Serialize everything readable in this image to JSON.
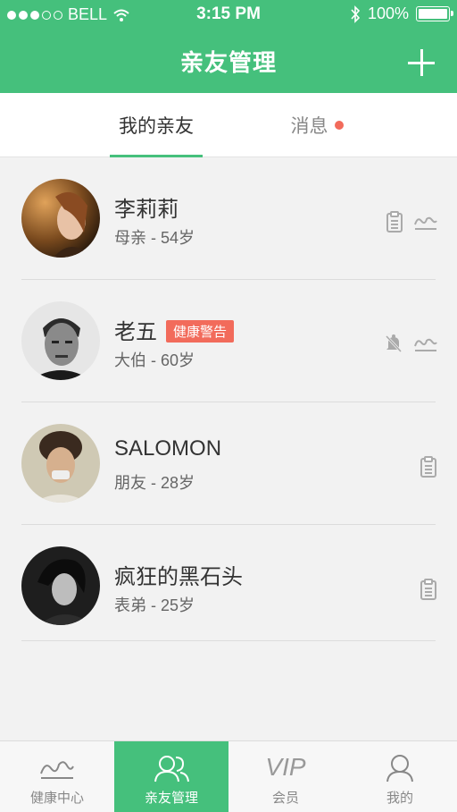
{
  "status_bar": {
    "carrier": "BELL",
    "time": "3:15 PM",
    "battery": "100%"
  },
  "header": {
    "title": "亲友管理",
    "add_icon": "plus-icon"
  },
  "tabs": [
    {
      "label": "我的亲友",
      "active": true
    },
    {
      "label": "消息",
      "has_unread": true
    }
  ],
  "contacts": [
    {
      "name": "李莉莉",
      "relation": "母亲 - 54岁",
      "badge": "",
      "icons": [
        "clipboard-icon",
        "health-trend-icon"
      ]
    },
    {
      "name": "老五",
      "relation": "大伯 - 60岁",
      "badge": "健康警告",
      "icons": [
        "bell-muted-icon",
        "health-trend-icon"
      ]
    },
    {
      "name": "SALOMON",
      "relation": "朋友 - 28岁",
      "badge": "",
      "icons": [
        "clipboard-icon"
      ]
    },
    {
      "name": "疯狂的黑石头",
      "relation": "表弟 - 25岁",
      "badge": "",
      "icons": [
        "clipboard-icon"
      ]
    }
  ],
  "tabbar": [
    {
      "label": "健康中心",
      "icon": "health-trend-icon",
      "active": false
    },
    {
      "label": "亲友管理",
      "icon": "friends-icon",
      "active": true
    },
    {
      "label": "会员",
      "icon_text": "VIP",
      "active": false
    },
    {
      "label": "我的",
      "icon": "user-icon",
      "active": false
    }
  ],
  "colors": {
    "primary": "#45c07c",
    "alert": "#f26b5b"
  }
}
